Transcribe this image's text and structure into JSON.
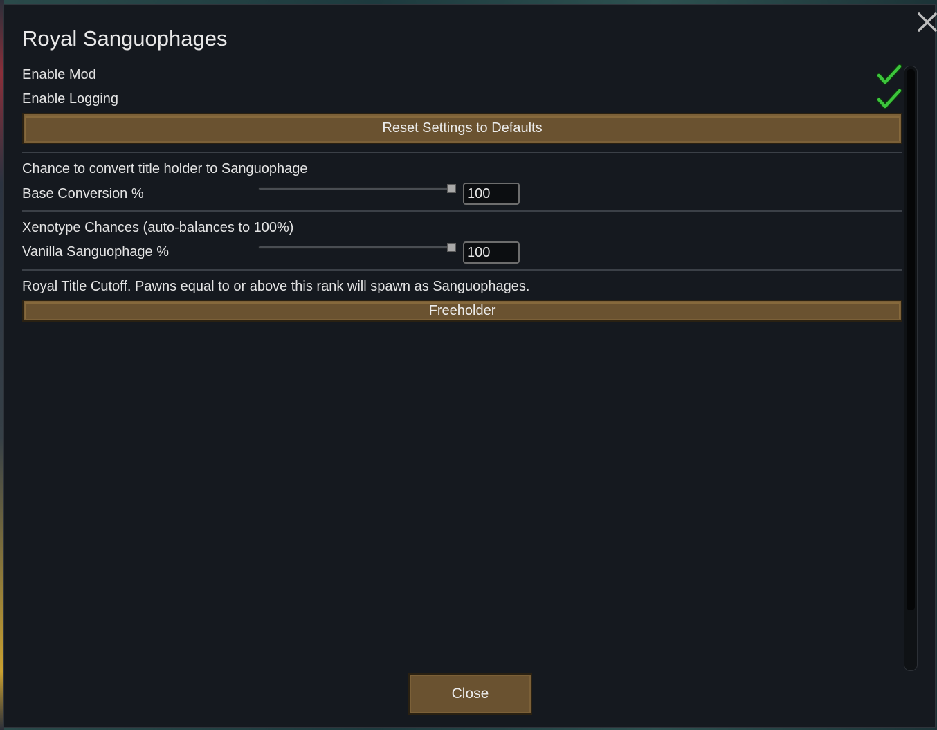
{
  "window": {
    "title": "Royal Sanguophages",
    "close_icon": "close-x-icon"
  },
  "toggles": [
    {
      "label": "Enable Mod",
      "checked": true,
      "icon": "checkmark-icon",
      "color": "#3cc43c"
    },
    {
      "label": "Enable Logging",
      "checked": true,
      "icon": "checkmark-icon",
      "color": "#3cc43c"
    }
  ],
  "reset_button": {
    "label": "Reset Settings to Defaults"
  },
  "conversion": {
    "heading": "Chance to convert title holder to Sanguophage",
    "slider_label": "Base Conversion %",
    "value": "100",
    "slider_fraction": 1.0
  },
  "xenotype": {
    "heading": "Xenotype Chances (auto-balances to 100%)",
    "slider_label": "Vanilla Sanguophage %",
    "value": "100",
    "slider_fraction": 1.0
  },
  "royal_title": {
    "heading": "Royal Title Cutoff. Pawns equal to or above this rank will spawn as Sanguophages.",
    "selected": "Freeholder"
  },
  "footer": {
    "close_label": "Close"
  },
  "colors": {
    "button_fill": "#6a5230",
    "background": "#15191f",
    "check_green": "#3cc43c"
  }
}
